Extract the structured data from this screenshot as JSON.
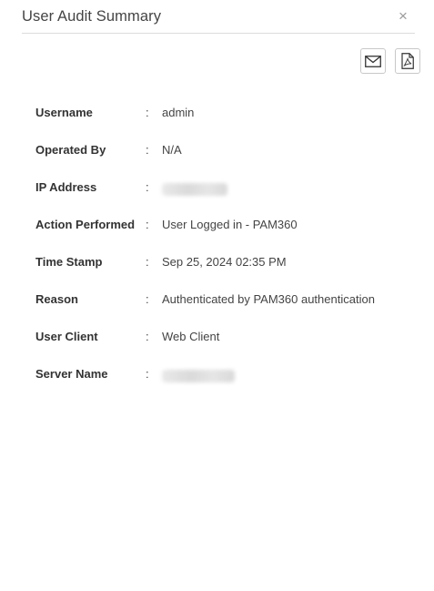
{
  "dialog": {
    "title": "User Audit Summary",
    "close_label": "×"
  },
  "actions": {
    "email_icon": "mail-icon",
    "pdf_icon": "pdf-icon"
  },
  "rows": [
    {
      "label": "Username",
      "separator": ":",
      "value": "admin"
    },
    {
      "label": "Operated By",
      "separator": ":",
      "value": "N/A"
    },
    {
      "label": "IP Address",
      "separator": ":",
      "value": ""
    },
    {
      "label": "Action Performed",
      "separator": ":",
      "value": "User Logged in - PAM360"
    },
    {
      "label": "Time Stamp",
      "separator": ":",
      "value": "Sep 25, 2024 02:35 PM"
    },
    {
      "label": "Reason",
      "separator": ":",
      "value": "Authenticated by PAM360 authentication"
    },
    {
      "label": "User Client",
      "separator": ":",
      "value": "Web Client"
    },
    {
      "label": "Server Name",
      "separator": ":",
      "value": ""
    }
  ]
}
